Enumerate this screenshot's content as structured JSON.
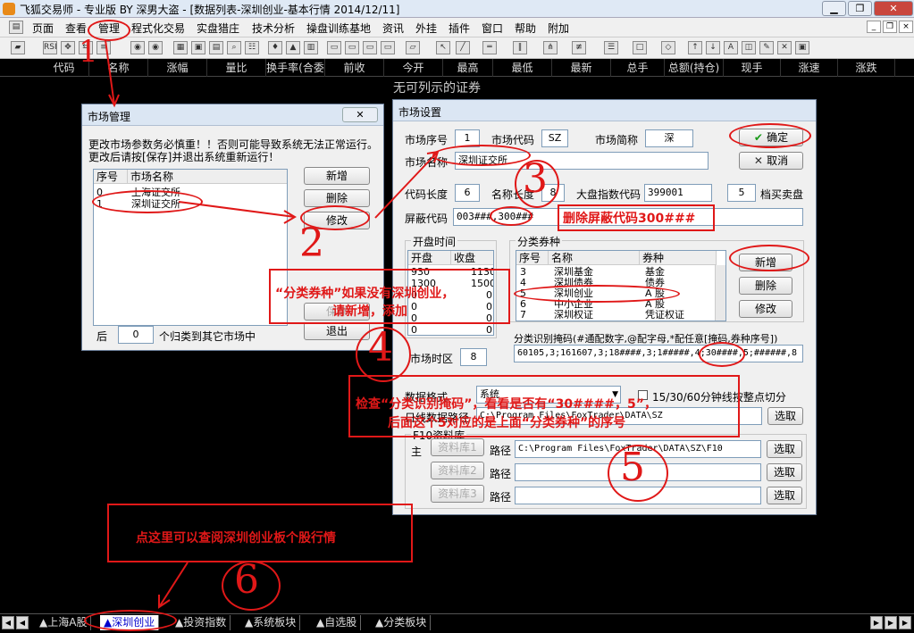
{
  "app": {
    "title": "飞狐交易师 - 专业版 BY 深男大盗 - [数据列表-深圳创业-基本行情 2014/12/11]"
  },
  "menu": [
    "页面",
    "查看",
    "管理",
    "程式化交易",
    "实盘猎庄",
    "技术分析",
    "操盘训练基地",
    "资讯",
    "外挂",
    "插件",
    "窗口",
    "帮助",
    "附加"
  ],
  "columns": [
    "代码",
    "名称",
    "涨幅",
    "量比",
    "换手率(合委",
    "前收",
    "今开",
    "最高",
    "最低",
    "最新",
    "总手",
    "总额(持仓)",
    "现手",
    "涨速",
    "涨跌"
  ],
  "main_message": "无可列示的证券",
  "market_manage": {
    "title": "市场管理",
    "close": "✕",
    "notice_1": "更改市场参数务必慎重！！否则可能导致系统无法正常运行。",
    "notice_2": "更改后请按[保存]并退出系统重新运行！",
    "header_no": "序号",
    "header_name": "市场名称",
    "rows": [
      {
        "no": "0",
        "name": "上海证交所"
      },
      {
        "no": "1",
        "name": "深圳证交所"
      }
    ],
    "btn_add": "新增",
    "btn_delete": "删除",
    "btn_modify": "修改",
    "btn_save": "保存",
    "btn_exit": "退出",
    "after_label": "后",
    "after_value": "0",
    "after_suffix": "个归类到其它市场中"
  },
  "market_settings": {
    "title": "市场设置",
    "seq_label": "市场序号",
    "seq_value": "1",
    "code_label": "市场代码",
    "code_value": "SZ",
    "short_label": "市场简称",
    "short_value": "深",
    "name_label": "市场名称",
    "name_value": "深圳证交所",
    "btn_ok": "确定",
    "btn_cancel": "取消",
    "code_len_label": "代码长度",
    "code_len_value": "6",
    "name_len_label": "名称长度",
    "name_len_value": "8",
    "index_label": "大盘指数代码",
    "index_value": "399001",
    "depth_value": "5",
    "depth_label": "档买卖盘",
    "block_label": "屏蔽代码",
    "block_value": "003###,300###",
    "open_group": "开盘时间",
    "open_header": "开盘",
    "close_header": "收盘",
    "sessions": [
      {
        "open": "930",
        "close": "1130"
      },
      {
        "open": "1300",
        "close": "1500"
      },
      {
        "open": "0",
        "close": "0"
      },
      {
        "open": "0",
        "close": "0"
      },
      {
        "open": "0",
        "close": "0"
      },
      {
        "open": "0",
        "close": "0"
      }
    ],
    "category_group": "分类券种",
    "cat_header_no": "序号",
    "cat_header_name": "名称",
    "cat_header_type": "券种",
    "categories": [
      {
        "no": "3",
        "name": "深圳基金",
        "type": "基金"
      },
      {
        "no": "4",
        "name": "深圳债券",
        "type": "债券"
      },
      {
        "no": "5",
        "name": "深圳创业",
        "type": "A 股"
      },
      {
        "no": "6",
        "name": "中小企业",
        "type": "A 股"
      },
      {
        "no": "7",
        "name": "深圳权证",
        "type": "凭证权证"
      }
    ],
    "btn_cat_add": "新增",
    "btn_cat_delete": "删除",
    "btn_cat_modify": "修改",
    "mask_label": "分类识别掩码(#通配数字,@配字母,*配任意[掩码,券种序号])",
    "mask_value": "60105,3;161607,3;18####,3;1#####,4;30####,5;######,8",
    "timezone_label": "市场时区",
    "timezone_value": "8",
    "format_label": "数据格式",
    "format_value": "系统",
    "checkbox_label": "15/30/60分钟线按整点切分",
    "path_label": "日线数据路径",
    "path_value": "C:\\Program Files\\FoxTrader\\DATA\\SZ",
    "btn_select": "选取",
    "f10_group": "F10资料库",
    "f10_main": "主",
    "f10_rows": [
      {
        "name": "资料库1",
        "path_label": "路径",
        "path": "C:\\Program Files\\FoxTrader\\DATA\\SZ\\F10",
        "btn": "选取"
      },
      {
        "name": "资料库2",
        "path_label": "路径",
        "path": "",
        "btn": "选取"
      },
      {
        "name": "资料库3",
        "path_label": "路径",
        "path": "",
        "btn": "选取"
      }
    ]
  },
  "annotations": {
    "num_1": "1",
    "num_2": "2",
    "num_3": "3",
    "num_4": "4",
    "num_5": "5",
    "num_6": "6",
    "note_delete_block": "删除屏蔽代码300###",
    "note_add_category_1": "“分类券种”如果没有深圳创业，",
    "note_add_category_2": "请新增，添加",
    "note_check_mask_1": "检查“分类识别掩码”，看看是否有“30####，5”，",
    "note_check_mask_2": "后面这个5对应的是上面“分类券种”的序号",
    "note_click_here": "点这里可以查阅深圳创业板个股行情"
  },
  "tabs": [
    "▲上海A股",
    "▲深圳创业",
    "▲投资指数",
    "▲系统板块",
    "▲自选股",
    "▲分类板块"
  ],
  "selected_tab": "▲深圳创业",
  "colors": {
    "annotation": "#e01818",
    "tab_selected_text": "#0000cc"
  }
}
